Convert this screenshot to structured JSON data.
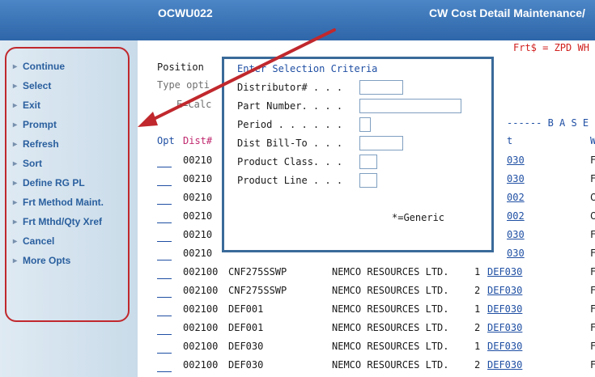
{
  "header": {
    "program": "OCWU022",
    "title": "CW Cost Detail Maintenance/"
  },
  "sidebar": {
    "items": [
      {
        "label": "Continue"
      },
      {
        "label": "Select"
      },
      {
        "label": "Exit"
      },
      {
        "label": "Prompt"
      },
      {
        "label": "Refresh"
      },
      {
        "label": "Sort"
      },
      {
        "label": "Define RG PL"
      },
      {
        "label": "Frt Method Maint."
      },
      {
        "label": "Frt Mthd/Qty Xref"
      },
      {
        "label": "Cancel"
      },
      {
        "label": "More Opts"
      }
    ]
  },
  "screen": {
    "frt_note": "Frt$ = ZPD WH",
    "position_label": "Position",
    "type_options_label": "Type opti",
    "ecalc_label": "E=Calc",
    "base_header": "------ B A S E",
    "col_opt": "Opt",
    "col_dist": "Dist#",
    "col_t": "t",
    "col_w": "W"
  },
  "dialog": {
    "title": "Enter Selection Criteria",
    "fields": [
      {
        "label": "Distributor# . . .",
        "value": ""
      },
      {
        "label": "Part Number. . . .",
        "value": ""
      },
      {
        "label": "Period . . . . . .",
        "value": ""
      },
      {
        "label": "Dist Bill-To . . .",
        "value": ""
      },
      {
        "label": "Product Class. . .",
        "value": ""
      },
      {
        "label": "Product Line . . .",
        "value": ""
      }
    ],
    "generic_note": "*=Generic"
  },
  "rows": [
    {
      "dist": "00210",
      "part": "",
      "name": "",
      "seq": "",
      "link": "030",
      "w": "F"
    },
    {
      "dist": "00210",
      "part": "",
      "name": "",
      "seq": "",
      "link": "030",
      "w": "F"
    },
    {
      "dist": "00210",
      "part": "",
      "name": "",
      "seq": "",
      "link": "002",
      "w": "C"
    },
    {
      "dist": "00210",
      "part": "",
      "name": "",
      "seq": "",
      "link": "002",
      "w": "C"
    },
    {
      "dist": "00210",
      "part": "",
      "name": "",
      "seq": "",
      "link": "030",
      "w": "F"
    },
    {
      "dist": "00210",
      "part": "",
      "name": "",
      "seq": "",
      "link": "030",
      "w": "F"
    },
    {
      "dist": "002100",
      "part": "CNF275SSWP",
      "name": "NEMCO RESOURCES LTD.",
      "seq": "1",
      "link": "DEF030",
      "w": "F"
    },
    {
      "dist": "002100",
      "part": "CNF275SSWP",
      "name": "NEMCO RESOURCES LTD.",
      "seq": "2",
      "link": "DEF030",
      "w": "F"
    },
    {
      "dist": "002100",
      "part": "DEF001",
      "name": "NEMCO RESOURCES LTD.",
      "seq": "1",
      "link": "DEF030",
      "w": "F"
    },
    {
      "dist": "002100",
      "part": "DEF001",
      "name": "NEMCO RESOURCES LTD.",
      "seq": "2",
      "link": "DEF030",
      "w": "F"
    },
    {
      "dist": "002100",
      "part": "DEF030",
      "name": "NEMCO RESOURCES LTD.",
      "seq": "1",
      "link": "DEF030",
      "w": "F"
    },
    {
      "dist": "002100",
      "part": "DEF030",
      "name": "NEMCO RESOURCES LTD.",
      "seq": "2",
      "link": "DEF030",
      "w": "F"
    }
  ]
}
